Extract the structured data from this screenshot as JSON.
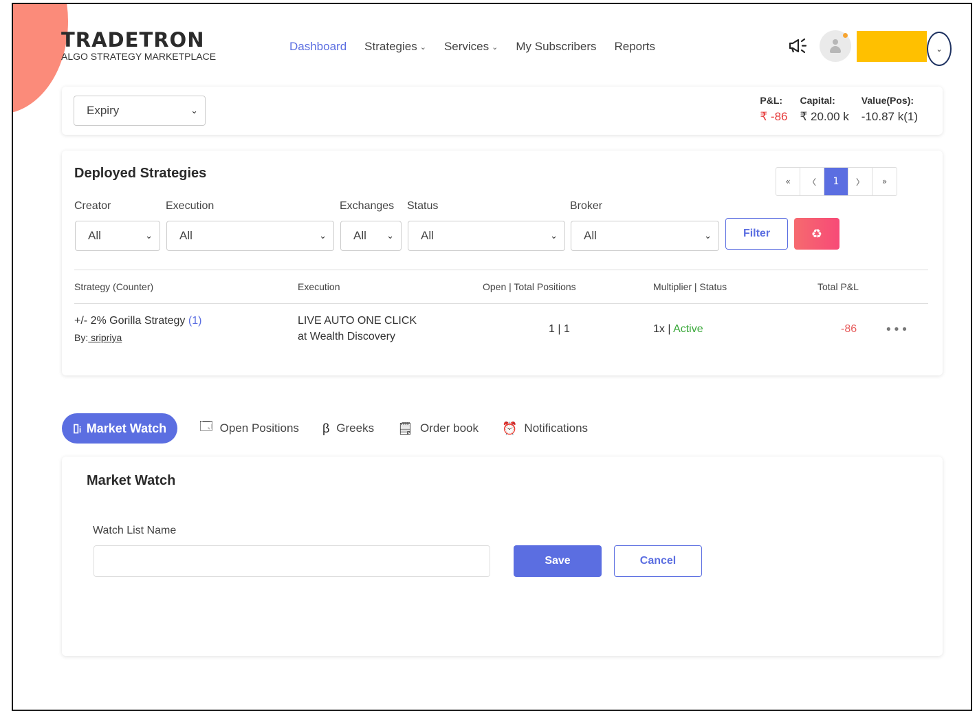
{
  "brand": {
    "name": "TRADETRON",
    "tagline": "ALGO STRATEGY MARKETPLACE"
  },
  "nav": {
    "dashboard": "Dashboard",
    "strategies": "Strategies",
    "services": "Services",
    "subscribers": "My Subscribers",
    "reports": "Reports"
  },
  "header": {
    "announce_icon": "megaphone-icon",
    "avatar_icon": "user-icon",
    "menu_chevron": "⌄"
  },
  "topbar": {
    "expiry_select": "Expiry",
    "pnl_label": "P&L:",
    "pnl_value": "₹ -86",
    "capital_label": "Capital:",
    "capital_value": "₹ 20.00 k",
    "value_label": "Value(Pos):",
    "value_value": "-10.87 k(1)"
  },
  "deployed": {
    "title": "Deployed Strategies",
    "pager": {
      "first": "«",
      "prev": "〈",
      "current": "1",
      "next": "〉",
      "last": "»"
    },
    "filters": {
      "creator_label": "Creator",
      "creator_value": "All",
      "execution_label": "Execution",
      "execution_value": "All",
      "exchanges_label": "Exchanges",
      "exchanges_value": "All",
      "status_label": "Status",
      "status_value": "All",
      "broker_label": "Broker",
      "broker_value": "All",
      "filter_button": "Filter",
      "reset_icon": "recycle-icon"
    },
    "columns": {
      "strategy": "Strategy (Counter)",
      "execution": "Execution",
      "positions": "Open | Total Positions",
      "multiplier": "Multiplier | Status",
      "pnl": "Total P&L"
    },
    "rows": [
      {
        "name": "+/- 2% Gorilla Strategy",
        "counter": "(1)",
        "by_label": "By:",
        "creator": " sripriya",
        "execution_line1": "LIVE AUTO ONE CLICK",
        "execution_line2": "at Wealth Discovery",
        "positions": "1 | 1",
        "multiplier": "1x |",
        "status": "Active",
        "pnl": "-86",
        "more": "•••"
      }
    ]
  },
  "tabs": {
    "market_watch": "Market Watch",
    "open_positions": "Open Positions",
    "greeks": "Greeks",
    "order_book": "Order book",
    "notifications": "Notifications"
  },
  "market_watch": {
    "title": "Market Watch",
    "field_label": "Watch List Name",
    "field_value": "",
    "field_placeholder": "",
    "save": "Save",
    "cancel": "Cancel"
  },
  "colors": {
    "accent": "#5b6ee1",
    "danger": "#e63838",
    "success": "#3aa83a",
    "highlight": "#ffc000",
    "blob": "#fb8b7a"
  }
}
